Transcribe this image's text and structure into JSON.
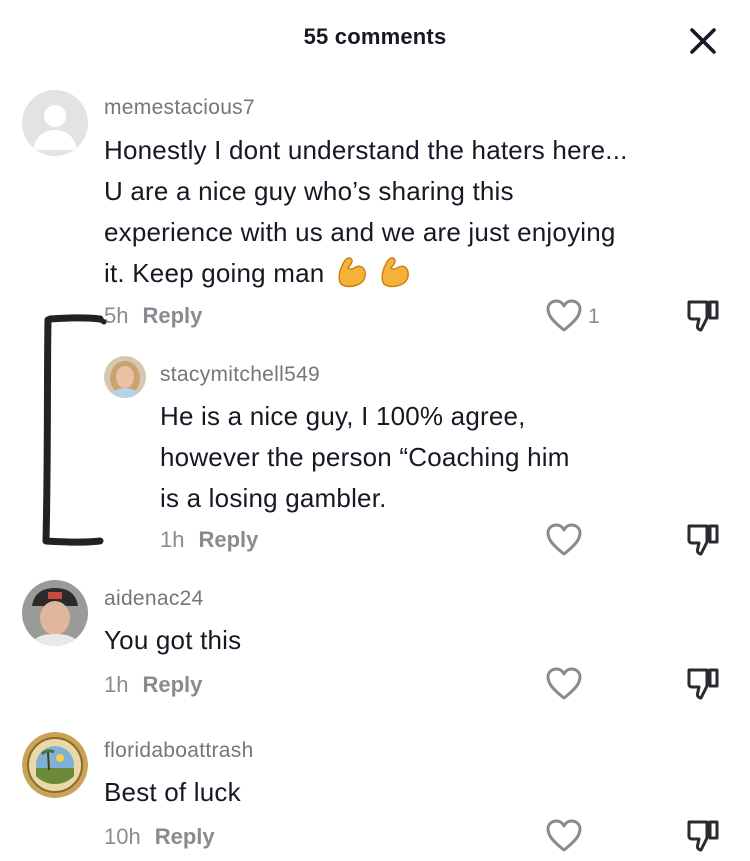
{
  "header": {
    "title": "55 comments"
  },
  "comments": [
    {
      "username": "memestacious7",
      "text": "Honestly I dont understand the haters here... U are a nice guy who’s sharing this experience with us and we are just enjoying it. Keep going man",
      "emoji_icon": "flexed-biceps-emoji",
      "time": "5h",
      "reply_label": "Reply",
      "like_count": "1"
    },
    {
      "username": "stacymitchell549",
      "text_line1": "He is a nice guy, I 100% agree,",
      "text_line2": "however the person “Coaching him",
      "text_line3": "is a losing gambler.",
      "time": "1h",
      "reply_label": "Reply"
    },
    {
      "username": "aidenac24",
      "text": "You got this",
      "time": "1h",
      "reply_label": "Reply"
    },
    {
      "username": "floridaboattrash",
      "text": "Best of luck",
      "time": "10h",
      "reply_label": "Reply"
    }
  ],
  "colors": {
    "text": "#161823",
    "muted": "#8a8b91",
    "username": "#767676",
    "annotation": "#222222"
  },
  "icons": [
    "close-icon",
    "heart-icon",
    "thumbs-down-icon",
    "default-avatar-icon",
    "hand-drawn-bracket"
  ]
}
